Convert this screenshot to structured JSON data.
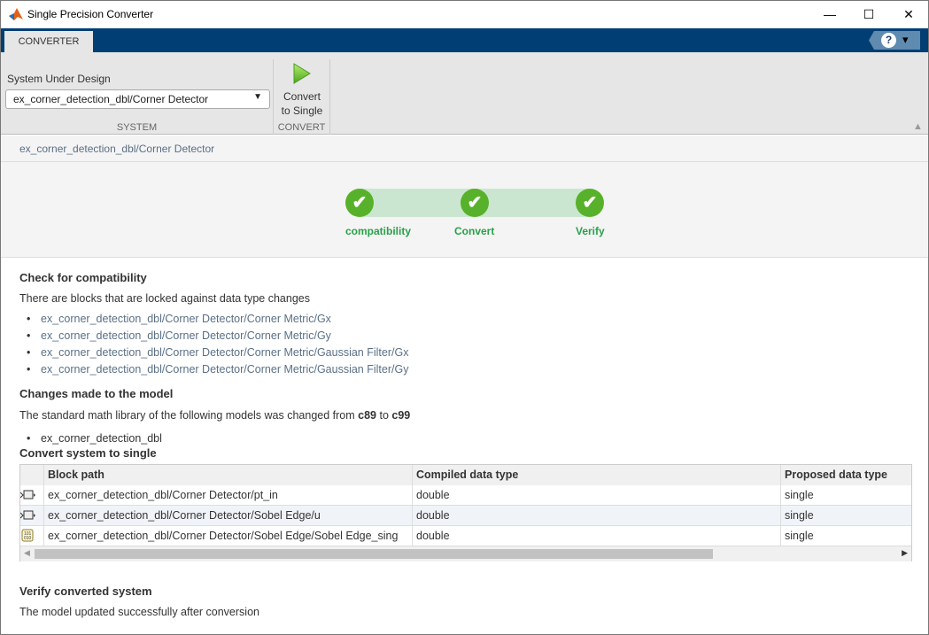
{
  "window": {
    "title": "Single Precision Converter",
    "minimize": "—",
    "maximize": "☐",
    "close": "✕"
  },
  "ribbon": {
    "tab": "CONVERTER",
    "help_icon": "?",
    "help_dropdown": "▾",
    "system_label": "System Under Design",
    "system_value": "ex_corner_detection_dbl/Corner Detector",
    "system_group": "SYSTEM",
    "convert_label_1": "Convert",
    "convert_label_2": "to Single",
    "convert_group": "CONVERT",
    "collapse_icon": "▲"
  },
  "breadcrumb": "ex_corner_detection_dbl/Corner Detector",
  "steps": [
    {
      "label": "compatibility",
      "status": "done"
    },
    {
      "label": "Convert",
      "status": "done"
    },
    {
      "label": "Verify",
      "status": "done"
    }
  ],
  "accent": "#58b12a",
  "compat": {
    "heading": "Check for compatibility",
    "text": "There are blocks that are locked against data type changes",
    "items": [
      "ex_corner_detection_dbl/Corner Detector/Corner Metric/Gx",
      "ex_corner_detection_dbl/Corner Detector/Corner Metric/Gy",
      "ex_corner_detection_dbl/Corner Detector/Corner Metric/Gaussian Filter/Gx",
      "ex_corner_detection_dbl/Corner Detector/Corner Metric/Gaussian Filter/Gy"
    ]
  },
  "changes": {
    "heading": "Changes made to the model",
    "text_pre": "The standard math library of the following models was changed from ",
    "from": "c89",
    "mid": " to ",
    "to": "c99",
    "items": [
      "ex_corner_detection_dbl"
    ]
  },
  "convert": {
    "heading": "Convert system to single",
    "columns": [
      "Block path",
      "Compiled data type",
      "Proposed data type"
    ],
    "rows": [
      {
        "icon": "inport-icon",
        "path": "ex_corner_detection_dbl/Corner Detector/pt_in",
        "compiled": "double",
        "proposed": "single"
      },
      {
        "icon": "inport-icon",
        "path": "ex_corner_detection_dbl/Corner Detector/Sobel Edge/u",
        "compiled": "double",
        "proposed": "single"
      },
      {
        "icon": "data-type-conversion-icon",
        "path": "ex_corner_detection_dbl/Corner Detector/Sobel Edge/Sobel Edge_sing",
        "compiled": "double",
        "proposed": "single"
      }
    ]
  },
  "verify": {
    "heading": "Verify converted system",
    "text": "The model updated successfully after conversion"
  }
}
